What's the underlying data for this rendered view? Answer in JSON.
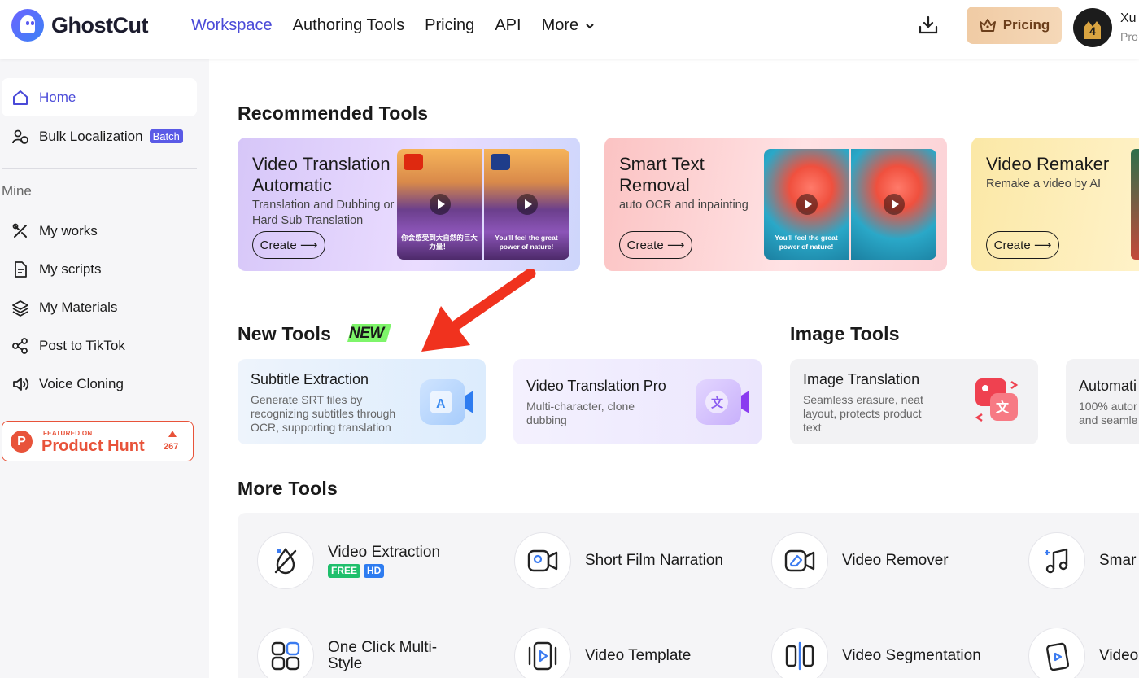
{
  "header": {
    "logo_text": "GhostCut",
    "nav": [
      "Workspace",
      "Authoring Tools",
      "Pricing",
      "API",
      "More"
    ],
    "pricing_button": "Pricing",
    "user_name": "Xu",
    "user_plan": "Pro",
    "avatar_level": "4"
  },
  "sidebar": {
    "home": "Home",
    "bulk": "Bulk Localization",
    "batch_badge": "Batch",
    "section_mine": "Mine",
    "items": [
      "My works",
      "My scripts",
      "My Materials",
      "Post to TikTok",
      "Voice Cloning"
    ],
    "product_hunt": {
      "featured": "FEATURED ON",
      "name": "Product Hunt",
      "votes": "267"
    }
  },
  "recommended": {
    "title": "Recommended Tools",
    "cards": [
      {
        "title": "Video Translation Automatic",
        "desc": "Translation and Dubbing or Hard Sub Translation",
        "button": "Create ⟶",
        "caption_left": "你会感受到大自然的巨大力量！",
        "caption_right": "You'll feel the great power of nature!"
      },
      {
        "title": "Smart Text Removal",
        "desc": "auto OCR and inpainting",
        "button": "Create ⟶",
        "caption_left": "You'll feel the great power of nature!"
      },
      {
        "title": "Video Remaker",
        "desc": "Remake a video by AI",
        "button": "Create ⟶"
      }
    ]
  },
  "new_tools": {
    "title": "New Tools",
    "badge": "NEW",
    "cards": [
      {
        "title": "Subtitle Extraction",
        "desc": "Generate SRT files by recognizing subtitles through OCR, supporting translation"
      },
      {
        "title": "Video Translation Pro",
        "desc": "Multi-character, clone dubbing"
      }
    ]
  },
  "image_tools": {
    "title": "Image Tools",
    "cards": [
      {
        "title": "Image Translation",
        "desc": "Seamless erasure, neat layout, protects product text"
      },
      {
        "title": "Automati",
        "desc": "100% autor and seamle"
      }
    ]
  },
  "more_tools": {
    "title": "More Tools",
    "items": [
      {
        "label": "Video Extraction",
        "pills": [
          "FREE",
          "HD"
        ]
      },
      {
        "label": "Short Film Narration"
      },
      {
        "label": "Video Remover"
      },
      {
        "label": "Smar"
      },
      {
        "label": "One Click Multi-Style"
      },
      {
        "label": "Video Template"
      },
      {
        "label": "Video Segmentation"
      },
      {
        "label": "Video"
      }
    ]
  },
  "colors": {
    "accent": "#4a4ad8",
    "annotation_arrow": "#f0321e",
    "product_hunt": "#e8533a"
  }
}
